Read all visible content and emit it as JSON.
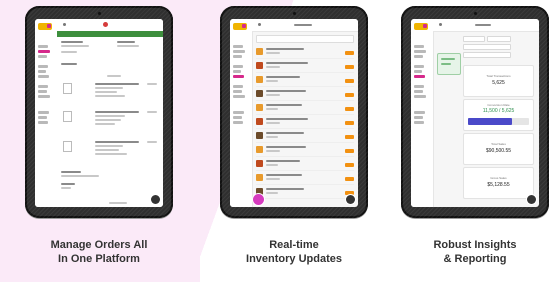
{
  "panels": [
    {
      "caption_line1": "Manage Orders All",
      "caption_line2": "In One Platform"
    },
    {
      "caption_line1": "Real-time",
      "caption_line2": "Inventory Updates"
    },
    {
      "caption_line1": "Robust Insights",
      "caption_line2": "& Reporting"
    }
  ],
  "reporting": {
    "cards": [
      {
        "label": "Total Transactions",
        "value": "5,625"
      },
      {
        "label": "Conversion Rate",
        "value": "11,500 / 5,625",
        "progress": 0.72
      },
      {
        "label": "Total Sales",
        "value": "$90,500.55"
      },
      {
        "label": "Gross Sales",
        "value": "$5,128.55"
      }
    ]
  },
  "colors": {
    "brand_pink": "#d6298b",
    "brand_yellow": "#f0b400",
    "order_green": "#3d8f3d",
    "progress_purple": "#4a49c9",
    "chip_orange": "#f29111"
  }
}
